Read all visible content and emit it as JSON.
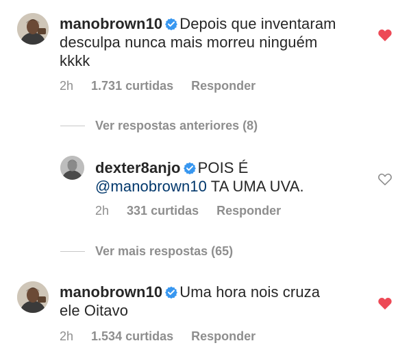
{
  "comments": [
    {
      "username": "manobrown10",
      "text": "Depois que inventaram desculpa nunca mais morreu ninguém kkkk",
      "line1": "Depois que inventaram",
      "line2": "desculpa nunca mais morreu ninguém",
      "line3": "kkkk",
      "time": "2h",
      "likes": "1.731 curtidas",
      "reply": "Responder",
      "liked": true,
      "like_icon": "heart-filled-icon",
      "verified_icon": "verified-badge-icon"
    },
    {
      "username": "dexter8anjo",
      "text": "POIS É @manobrown10 TA UMA UVA.",
      "line1": "POIS É",
      "mention": "@manobrown10",
      "line2_rest": " TA UMA UVA.",
      "time": "2h",
      "likes": "331 curtidas",
      "reply": "Responder",
      "liked": false,
      "like_icon": "heart-outline-icon",
      "verified_icon": "verified-badge-icon"
    },
    {
      "username": "manobrown10",
      "text": "Uma hora nois cruza ele Oitavo",
      "line1": "Uma hora nois cruza",
      "line2": "ele Oitavo",
      "time": "2h",
      "likes": "1.534 curtidas",
      "reply": "Responder",
      "liked": true,
      "like_icon": "heart-filled-icon",
      "verified_icon": "verified-badge-icon"
    }
  ],
  "thread_links": {
    "previous_replies": "Ver respostas anteriores (8)",
    "more_replies": "Ver mais respostas (65)"
  },
  "colors": {
    "text": "#262626",
    "muted": "#8e8e8e",
    "mention": "#00376b",
    "verified": "#3897f0",
    "liked": "#ed4956",
    "divider": "#c7c7c7"
  }
}
